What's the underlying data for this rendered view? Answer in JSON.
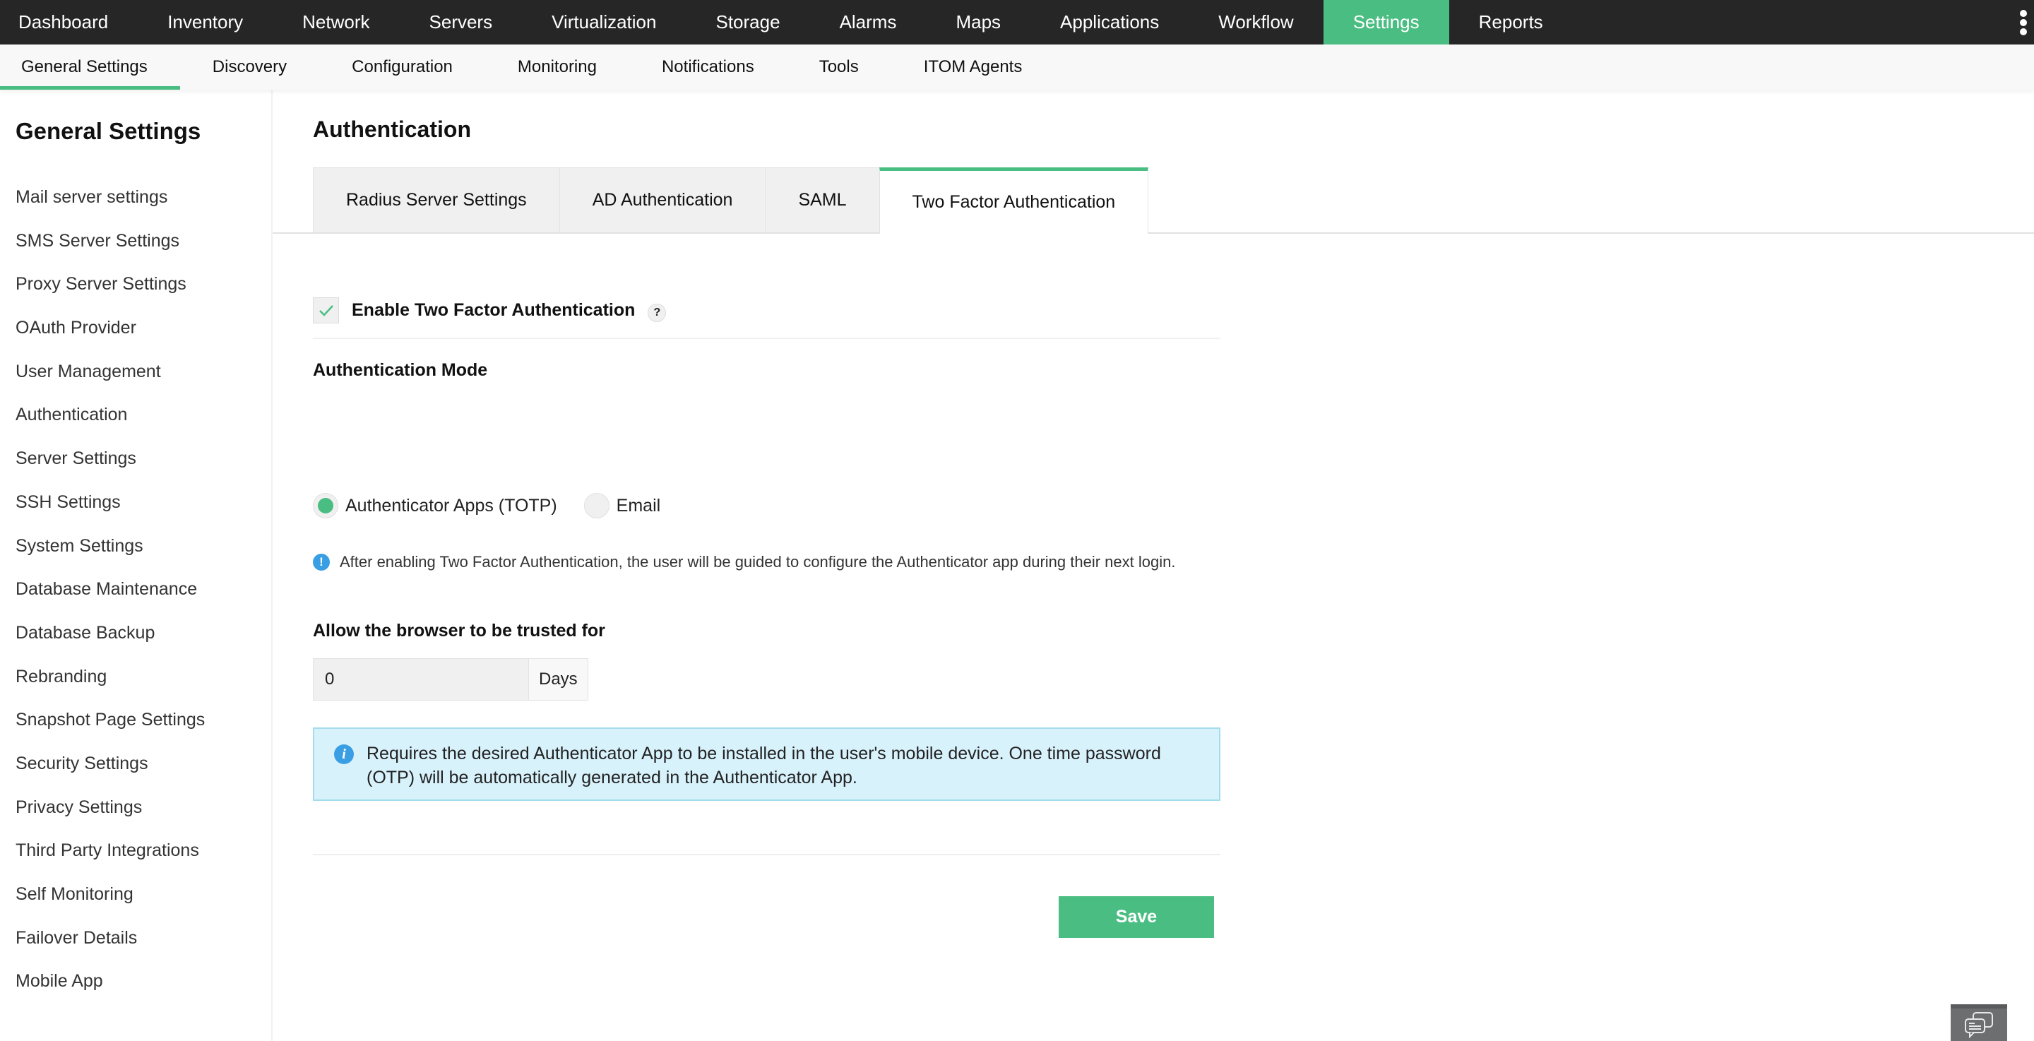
{
  "topnav": {
    "items": [
      {
        "label": "Dashboard",
        "active": false
      },
      {
        "label": "Inventory",
        "active": false
      },
      {
        "label": "Network",
        "active": false
      },
      {
        "label": "Servers",
        "active": false
      },
      {
        "label": "Virtualization",
        "active": false
      },
      {
        "label": "Storage",
        "active": false
      },
      {
        "label": "Alarms",
        "active": false
      },
      {
        "label": "Maps",
        "active": false
      },
      {
        "label": "Applications",
        "active": false
      },
      {
        "label": "Workflow",
        "active": false
      },
      {
        "label": "Settings",
        "active": true
      },
      {
        "label": "Reports",
        "active": false
      }
    ],
    "more_icon": "vertical-ellipsis-icon"
  },
  "subnav": {
    "items": [
      {
        "label": "General Settings",
        "active": true
      },
      {
        "label": "Discovery",
        "active": false
      },
      {
        "label": "Configuration",
        "active": false
      },
      {
        "label": "Monitoring",
        "active": false
      },
      {
        "label": "Notifications",
        "active": false
      },
      {
        "label": "Tools",
        "active": false
      },
      {
        "label": "ITOM Agents",
        "active": false
      }
    ]
  },
  "sidebar": {
    "title": "General Settings",
    "items": [
      "Mail server settings",
      "SMS Server Settings",
      "Proxy Server Settings",
      "OAuth Provider",
      "User Management",
      "Authentication",
      "Server Settings",
      "SSH Settings",
      "System Settings",
      "Database Maintenance",
      "Database Backup",
      "Rebranding",
      "Snapshot Page Settings",
      "Security Settings",
      "Privacy Settings",
      "Third Party Integrations",
      "Self Monitoring",
      "Failover Details",
      "Mobile App"
    ]
  },
  "main": {
    "title": "Authentication",
    "tabs": [
      {
        "label": "Radius Server Settings",
        "active": false
      },
      {
        "label": "AD Authentication",
        "active": false
      },
      {
        "label": "SAML",
        "active": false
      },
      {
        "label": "Two Factor Authentication",
        "active": true
      }
    ],
    "enable_2fa": {
      "label": "Enable Two Factor Authentication",
      "checked": true,
      "help_icon": "?"
    },
    "auth_mode": {
      "label": "Authentication Mode",
      "options": [
        {
          "label": "Authenticator Apps (TOTP)",
          "selected": true
        },
        {
          "label": "Email",
          "selected": false
        }
      ]
    },
    "note": {
      "icon": "!",
      "text": "After enabling Two Factor Authentication, the user will be guided to configure the Authenticator app during their next login."
    },
    "trust": {
      "label": "Allow the browser to be trusted for",
      "value": "0",
      "unit": "Days"
    },
    "info": {
      "icon": "i",
      "text": "Requires the desired Authenticator App to be installed in the user's mobile device. One time password (OTP) will be automatically generated in the Authenticator App."
    },
    "save_label": "Save"
  },
  "colors": {
    "accent": "#4abd82",
    "topbar": "#262626",
    "info_bg": "#d8f2fc",
    "info_icon": "#3a9ee4"
  },
  "chat_icon": "chat-bubbles-icon"
}
